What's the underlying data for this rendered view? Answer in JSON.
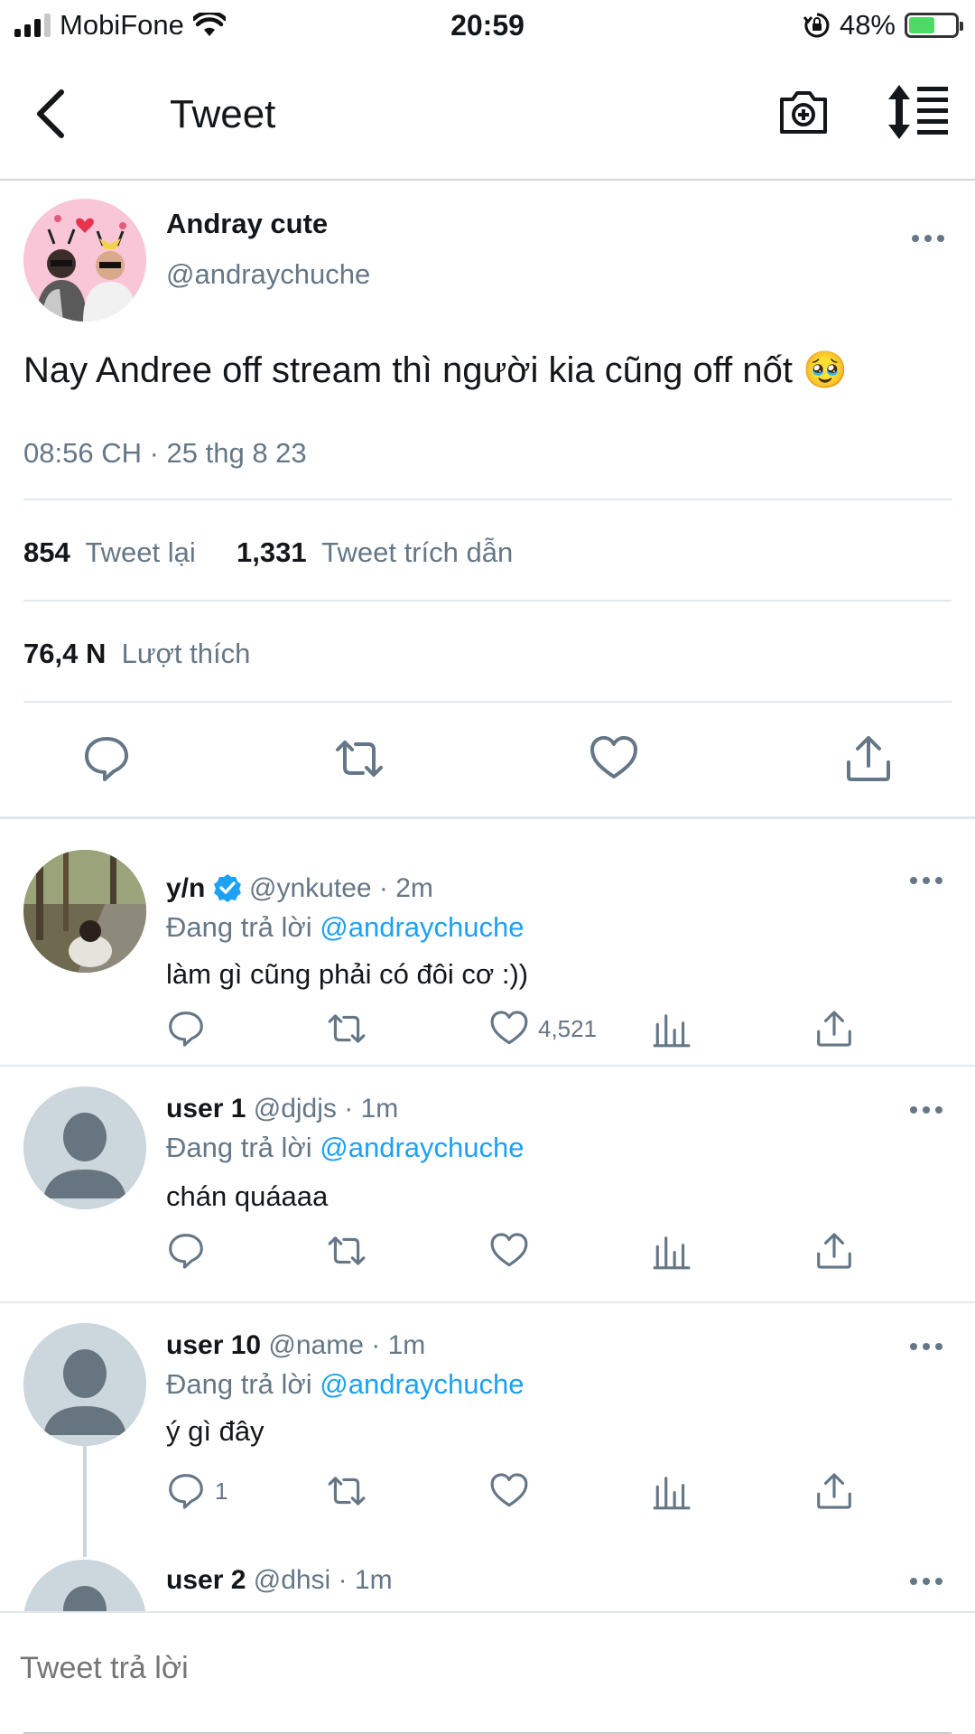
{
  "status_bar": {
    "carrier": "MobiFone",
    "time": "20:59",
    "battery": "48%"
  },
  "header": {
    "title": "Tweet"
  },
  "main_tweet": {
    "name": "Andray cute",
    "handle": "@andraychuche",
    "text": "Nay Andree off stream thì người kia cũng off nốt 🥹",
    "timestamp": "08:56 CH · 25 thg 8 23",
    "retweet_count": "854",
    "retweet_label": "Tweet lại",
    "quote_count": "1,331",
    "quote_label": "Tweet trích dẫn",
    "like_count": "76,4 N",
    "like_label": "Lượt thích"
  },
  "replies": [
    {
      "name": "y/n",
      "verified": true,
      "handle": "@ynkutee",
      "time": "· 2m",
      "replying_prefix": "Đang trả lời",
      "replying_to": "@andraychuche",
      "text": "làm gì cũng phải có đôi cơ :))",
      "reply_count": "",
      "like_count": "4,521"
    },
    {
      "name": "user 1",
      "handle": "@djdjs",
      "time": "· 1m",
      "replying_prefix": "Đang trả lời",
      "replying_to": "@andraychuche",
      "text": "chán quáaaa",
      "reply_count": "",
      "like_count": ""
    },
    {
      "name": "user 10",
      "handle": "@name",
      "time": "· 1m",
      "replying_prefix": "Đang trả lời",
      "replying_to": "@andraychuche",
      "text": "ý gì đây",
      "reply_count": "1",
      "like_count": ""
    },
    {
      "name": "user 2",
      "handle": "@dhsi",
      "time": "· 1m"
    }
  ],
  "compose": {
    "placeholder": "Tweet trả lời"
  },
  "colors": {
    "accent": "#1da1f2",
    "secondary_text": "#657786",
    "verified": "#1da1f2"
  }
}
